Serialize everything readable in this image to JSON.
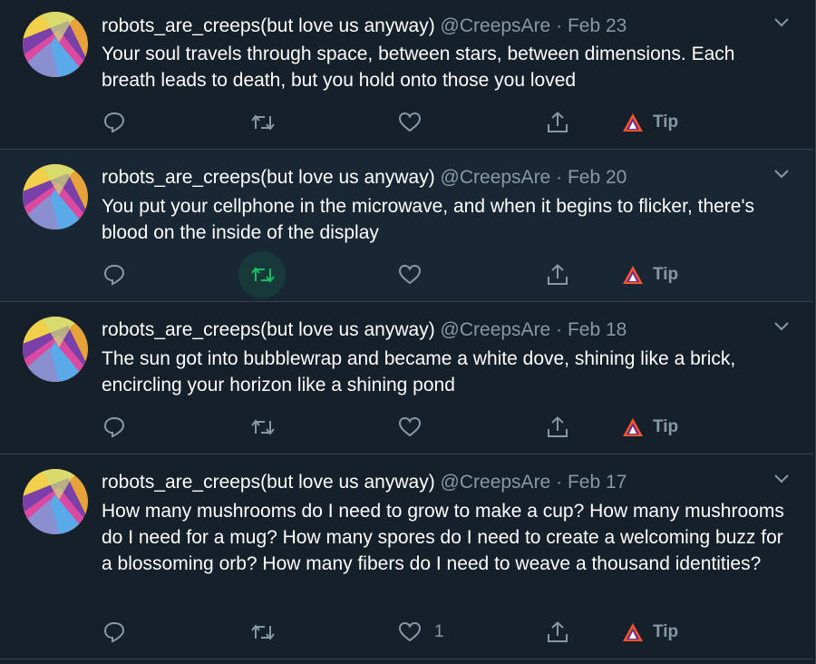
{
  "author": {
    "name": "robots_are_creeps(but love us anyway)",
    "handle": "@CreepsAre",
    "separator": "·"
  },
  "colors": {
    "background": "#15202b",
    "hover_background": "#192734",
    "divider": "#38444d",
    "muted": "#8899a6",
    "retweet_green": "#17bf63",
    "tip_accent": "#fb542b"
  },
  "icons": {
    "reply": "reply-icon",
    "retweet": "retweet-icon",
    "like": "heart-icon",
    "share": "share-icon",
    "tip": "brave-tip-icon",
    "menu": "chevron-down-icon"
  },
  "tip_label": "Tip",
  "tweets": [
    {
      "date": "Feb 23",
      "text": "Your soul travels through space, between stars, between dimensions. Each breath leads to death, but you hold onto those you loved",
      "like_count": ""
    },
    {
      "date": "Feb 20",
      "text": "You put your cellphone in the microwave, and when it begins to flicker, there's blood on the inside of the display",
      "like_count": ""
    },
    {
      "date": "Feb 18",
      "text": "The sun got into bubblewrap and became a white dove, shining like a brick, encircling your horizon like a shining pond",
      "like_count": ""
    },
    {
      "date": "Feb 17",
      "text": "How many mushrooms do I need to grow to make a cup? How many mushrooms do I need for a mug? How many spores do I need to create a welcoming buzz for a blossoming orb? How many fibers do I need to weave a thousand identities?",
      "like_count": "1"
    }
  ]
}
